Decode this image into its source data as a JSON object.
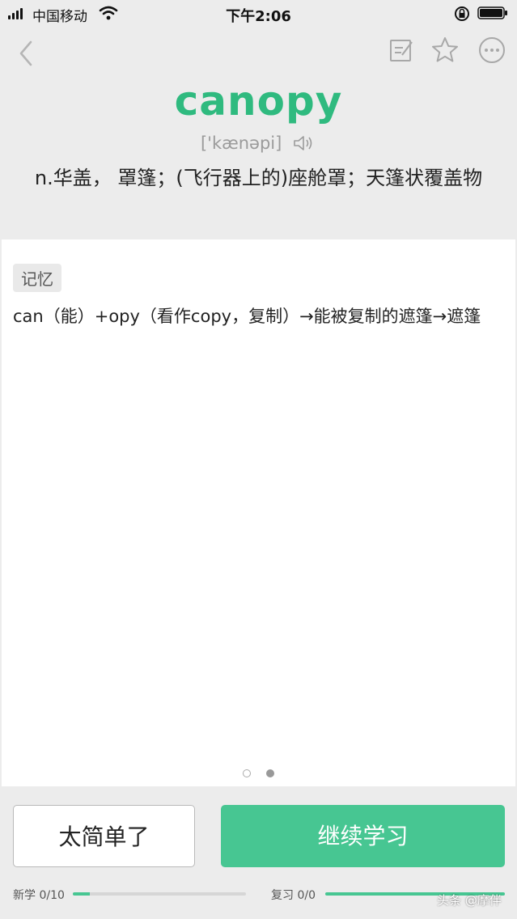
{
  "status_bar": {
    "carrier": "中国移动",
    "time": "下午2:06"
  },
  "entry": {
    "word": "canopy",
    "phonetic": "['kænəpi]",
    "definition": "n.华盖， 罩篷；(飞行器上的)座舱罩；天篷状覆盖物"
  },
  "card": {
    "tag": "记忆",
    "memo": "can（能）+opy（看作copy，复制）→能被复制的遮篷→遮篷",
    "page_dots": {
      "total": 2,
      "active_index": 1
    }
  },
  "actions": {
    "easy_label": "太简单了",
    "continue_label": "继续学习"
  },
  "progress": {
    "new_label": "新学 0/10",
    "new_fraction": 0.1,
    "review_label": "复习 0/0",
    "review_fraction": 1.0
  },
  "watermark": "头条 @摩伴",
  "colors": {
    "accent": "#47c692",
    "word": "#2fba7f"
  }
}
